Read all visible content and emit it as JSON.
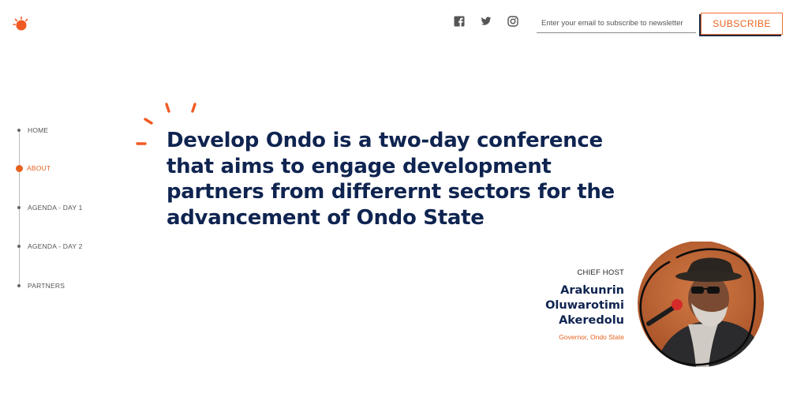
{
  "brand": {
    "logo_icon": "sun-logo-icon",
    "accent": "#e8621f",
    "navy": "#0f2450"
  },
  "header": {
    "social": [
      {
        "name": "facebook-icon"
      },
      {
        "name": "twitter-icon"
      },
      {
        "name": "instagram-icon"
      }
    ],
    "newsletter": {
      "placeholder": "Enter your email to subscribe to newsletter",
      "value": "",
      "button_label": "SUBSCRIBE"
    }
  },
  "sidenav": {
    "items": [
      {
        "label": "HOME",
        "active": false
      },
      {
        "label": "ABOUT",
        "active": true
      },
      {
        "label": "AGENDA - DAY 1",
        "active": false
      },
      {
        "label": "AGENDA - DAY 2",
        "active": false
      },
      {
        "label": "PARTNERS",
        "active": false
      }
    ]
  },
  "hero": {
    "headline": "Develop Ondo is a two-day conference that aims to engage development partners from differernt sectors for the advancement of Ondo State"
  },
  "host": {
    "role": "CHIEF HOST",
    "name_line1": "Arakunrin",
    "name_line2": "Oluwarotimi",
    "name_line3": "Akeredolu",
    "title": "Governor, Ondo State"
  }
}
